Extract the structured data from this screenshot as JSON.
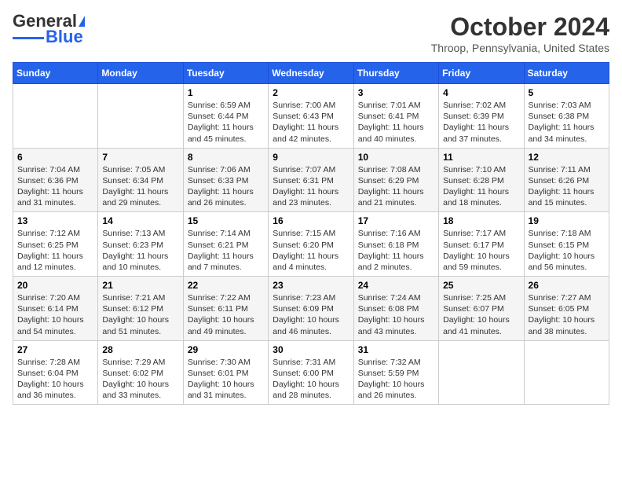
{
  "logo": {
    "general": "General",
    "blue": "Blue"
  },
  "title": "October 2024",
  "location": "Throop, Pennsylvania, United States",
  "days_of_week": [
    "Sunday",
    "Monday",
    "Tuesday",
    "Wednesday",
    "Thursday",
    "Friday",
    "Saturday"
  ],
  "weeks": [
    [
      {
        "day": "",
        "info": ""
      },
      {
        "day": "",
        "info": ""
      },
      {
        "day": "1",
        "info": "Sunrise: 6:59 AM\nSunset: 6:44 PM\nDaylight: 11 hours and 45 minutes."
      },
      {
        "day": "2",
        "info": "Sunrise: 7:00 AM\nSunset: 6:43 PM\nDaylight: 11 hours and 42 minutes."
      },
      {
        "day": "3",
        "info": "Sunrise: 7:01 AM\nSunset: 6:41 PM\nDaylight: 11 hours and 40 minutes."
      },
      {
        "day": "4",
        "info": "Sunrise: 7:02 AM\nSunset: 6:39 PM\nDaylight: 11 hours and 37 minutes."
      },
      {
        "day": "5",
        "info": "Sunrise: 7:03 AM\nSunset: 6:38 PM\nDaylight: 11 hours and 34 minutes."
      }
    ],
    [
      {
        "day": "6",
        "info": "Sunrise: 7:04 AM\nSunset: 6:36 PM\nDaylight: 11 hours and 31 minutes."
      },
      {
        "day": "7",
        "info": "Sunrise: 7:05 AM\nSunset: 6:34 PM\nDaylight: 11 hours and 29 minutes."
      },
      {
        "day": "8",
        "info": "Sunrise: 7:06 AM\nSunset: 6:33 PM\nDaylight: 11 hours and 26 minutes."
      },
      {
        "day": "9",
        "info": "Sunrise: 7:07 AM\nSunset: 6:31 PM\nDaylight: 11 hours and 23 minutes."
      },
      {
        "day": "10",
        "info": "Sunrise: 7:08 AM\nSunset: 6:29 PM\nDaylight: 11 hours and 21 minutes."
      },
      {
        "day": "11",
        "info": "Sunrise: 7:10 AM\nSunset: 6:28 PM\nDaylight: 11 hours and 18 minutes."
      },
      {
        "day": "12",
        "info": "Sunrise: 7:11 AM\nSunset: 6:26 PM\nDaylight: 11 hours and 15 minutes."
      }
    ],
    [
      {
        "day": "13",
        "info": "Sunrise: 7:12 AM\nSunset: 6:25 PM\nDaylight: 11 hours and 12 minutes."
      },
      {
        "day": "14",
        "info": "Sunrise: 7:13 AM\nSunset: 6:23 PM\nDaylight: 11 hours and 10 minutes."
      },
      {
        "day": "15",
        "info": "Sunrise: 7:14 AM\nSunset: 6:21 PM\nDaylight: 11 hours and 7 minutes."
      },
      {
        "day": "16",
        "info": "Sunrise: 7:15 AM\nSunset: 6:20 PM\nDaylight: 11 hours and 4 minutes."
      },
      {
        "day": "17",
        "info": "Sunrise: 7:16 AM\nSunset: 6:18 PM\nDaylight: 11 hours and 2 minutes."
      },
      {
        "day": "18",
        "info": "Sunrise: 7:17 AM\nSunset: 6:17 PM\nDaylight: 10 hours and 59 minutes."
      },
      {
        "day": "19",
        "info": "Sunrise: 7:18 AM\nSunset: 6:15 PM\nDaylight: 10 hours and 56 minutes."
      }
    ],
    [
      {
        "day": "20",
        "info": "Sunrise: 7:20 AM\nSunset: 6:14 PM\nDaylight: 10 hours and 54 minutes."
      },
      {
        "day": "21",
        "info": "Sunrise: 7:21 AM\nSunset: 6:12 PM\nDaylight: 10 hours and 51 minutes."
      },
      {
        "day": "22",
        "info": "Sunrise: 7:22 AM\nSunset: 6:11 PM\nDaylight: 10 hours and 49 minutes."
      },
      {
        "day": "23",
        "info": "Sunrise: 7:23 AM\nSunset: 6:09 PM\nDaylight: 10 hours and 46 minutes."
      },
      {
        "day": "24",
        "info": "Sunrise: 7:24 AM\nSunset: 6:08 PM\nDaylight: 10 hours and 43 minutes."
      },
      {
        "day": "25",
        "info": "Sunrise: 7:25 AM\nSunset: 6:07 PM\nDaylight: 10 hours and 41 minutes."
      },
      {
        "day": "26",
        "info": "Sunrise: 7:27 AM\nSunset: 6:05 PM\nDaylight: 10 hours and 38 minutes."
      }
    ],
    [
      {
        "day": "27",
        "info": "Sunrise: 7:28 AM\nSunset: 6:04 PM\nDaylight: 10 hours and 36 minutes."
      },
      {
        "day": "28",
        "info": "Sunrise: 7:29 AM\nSunset: 6:02 PM\nDaylight: 10 hours and 33 minutes."
      },
      {
        "day": "29",
        "info": "Sunrise: 7:30 AM\nSunset: 6:01 PM\nDaylight: 10 hours and 31 minutes."
      },
      {
        "day": "30",
        "info": "Sunrise: 7:31 AM\nSunset: 6:00 PM\nDaylight: 10 hours and 28 minutes."
      },
      {
        "day": "31",
        "info": "Sunrise: 7:32 AM\nSunset: 5:59 PM\nDaylight: 10 hours and 26 minutes."
      },
      {
        "day": "",
        "info": ""
      },
      {
        "day": "",
        "info": ""
      }
    ]
  ]
}
